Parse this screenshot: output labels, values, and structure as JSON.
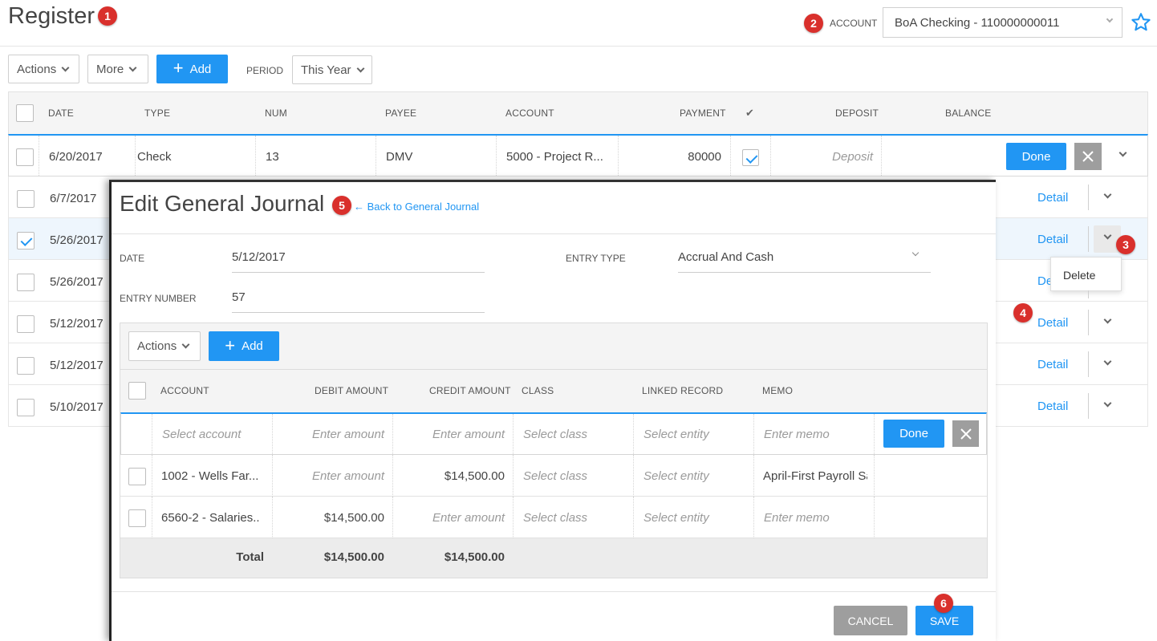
{
  "register": {
    "title": "Register",
    "account_label": "ACCOUNT",
    "account_value": "BoA Checking - 110000000011",
    "toolbar": {
      "actions": "Actions",
      "more": "More",
      "add": "Add",
      "period_label": "PERIOD",
      "period_value": "This Year"
    },
    "columns": {
      "date": "DATE",
      "type": "TYPE",
      "num": "NUM",
      "payee": "PAYEE",
      "account": "ACCOUNT",
      "payment": "PAYMENT",
      "check": "✔",
      "deposit": "DEPOSIT",
      "balance": "BALANCE"
    },
    "edit_row": {
      "date": "6/20/2017",
      "type": "Check",
      "num": "13",
      "payee": "DMV",
      "account": "5000 - Project R...",
      "payment": "80000",
      "deposit_placeholder": "Deposit",
      "done": "Done"
    },
    "rows": [
      {
        "date": "6/7/2017",
        "checked": false,
        "detail": "Detail"
      },
      {
        "date": "5/26/2017",
        "checked": true,
        "detail": "Detail"
      },
      {
        "date": "5/26/2017",
        "checked": false,
        "detail": "Detail"
      },
      {
        "date": "5/12/2017",
        "checked": false,
        "detail": "Detail"
      },
      {
        "date": "5/12/2017",
        "checked": false,
        "detail": "Detail"
      },
      {
        "date": "5/10/2017",
        "checked": false,
        "detail": "Detail"
      }
    ],
    "dropdown_menu": {
      "delete": "Delete"
    }
  },
  "badges": {
    "b1": "1",
    "b2": "2",
    "b3": "3",
    "b4": "4",
    "b5": "5",
    "b6": "6"
  },
  "journal": {
    "title": "Edit General Journal",
    "back_link": "← Back to General Journal",
    "date_label": "DATE",
    "date_value": "5/12/2017",
    "entry_type_label": "ENTRY TYPE",
    "entry_type_value": "Accrual And Cash",
    "entry_number_label": "ENTRY NUMBER",
    "entry_number_value": "57",
    "toolbar": {
      "actions": "Actions",
      "add": "Add"
    },
    "columns": {
      "account": "ACCOUNT",
      "debit": "DEBIT AMOUNT",
      "credit": "CREDIT AMOUNT",
      "class": "CLASS",
      "linked": "LINKED RECORD",
      "memo": "MEMO"
    },
    "edit_line": {
      "account": "Select account",
      "debit": "Enter amount",
      "credit": "Enter amount",
      "class": "Select class",
      "linked": "Select entity",
      "memo": "Enter memo",
      "done": "Done"
    },
    "lines": [
      {
        "account": "1002 - Wells Far...",
        "debit": "Enter amount",
        "credit": "$14,500.00",
        "class": "Select class",
        "linked": "Select entity",
        "memo": "April-First Payroll Sa"
      },
      {
        "account": "6560-2 - Salaries..",
        "debit": "$14,500.00",
        "credit": "Enter amount",
        "class": "Select class",
        "linked": "Select entity",
        "memo": "Enter memo"
      }
    ],
    "total_label": "Total",
    "total_debit": "$14,500.00",
    "total_credit": "$14,500.00",
    "cancel": "CANCEL",
    "save": "SAVE"
  },
  "colors": {
    "accent": "#2196f3",
    "badge": "#d9302c",
    "cancel_bg": "#9e9e9e"
  }
}
